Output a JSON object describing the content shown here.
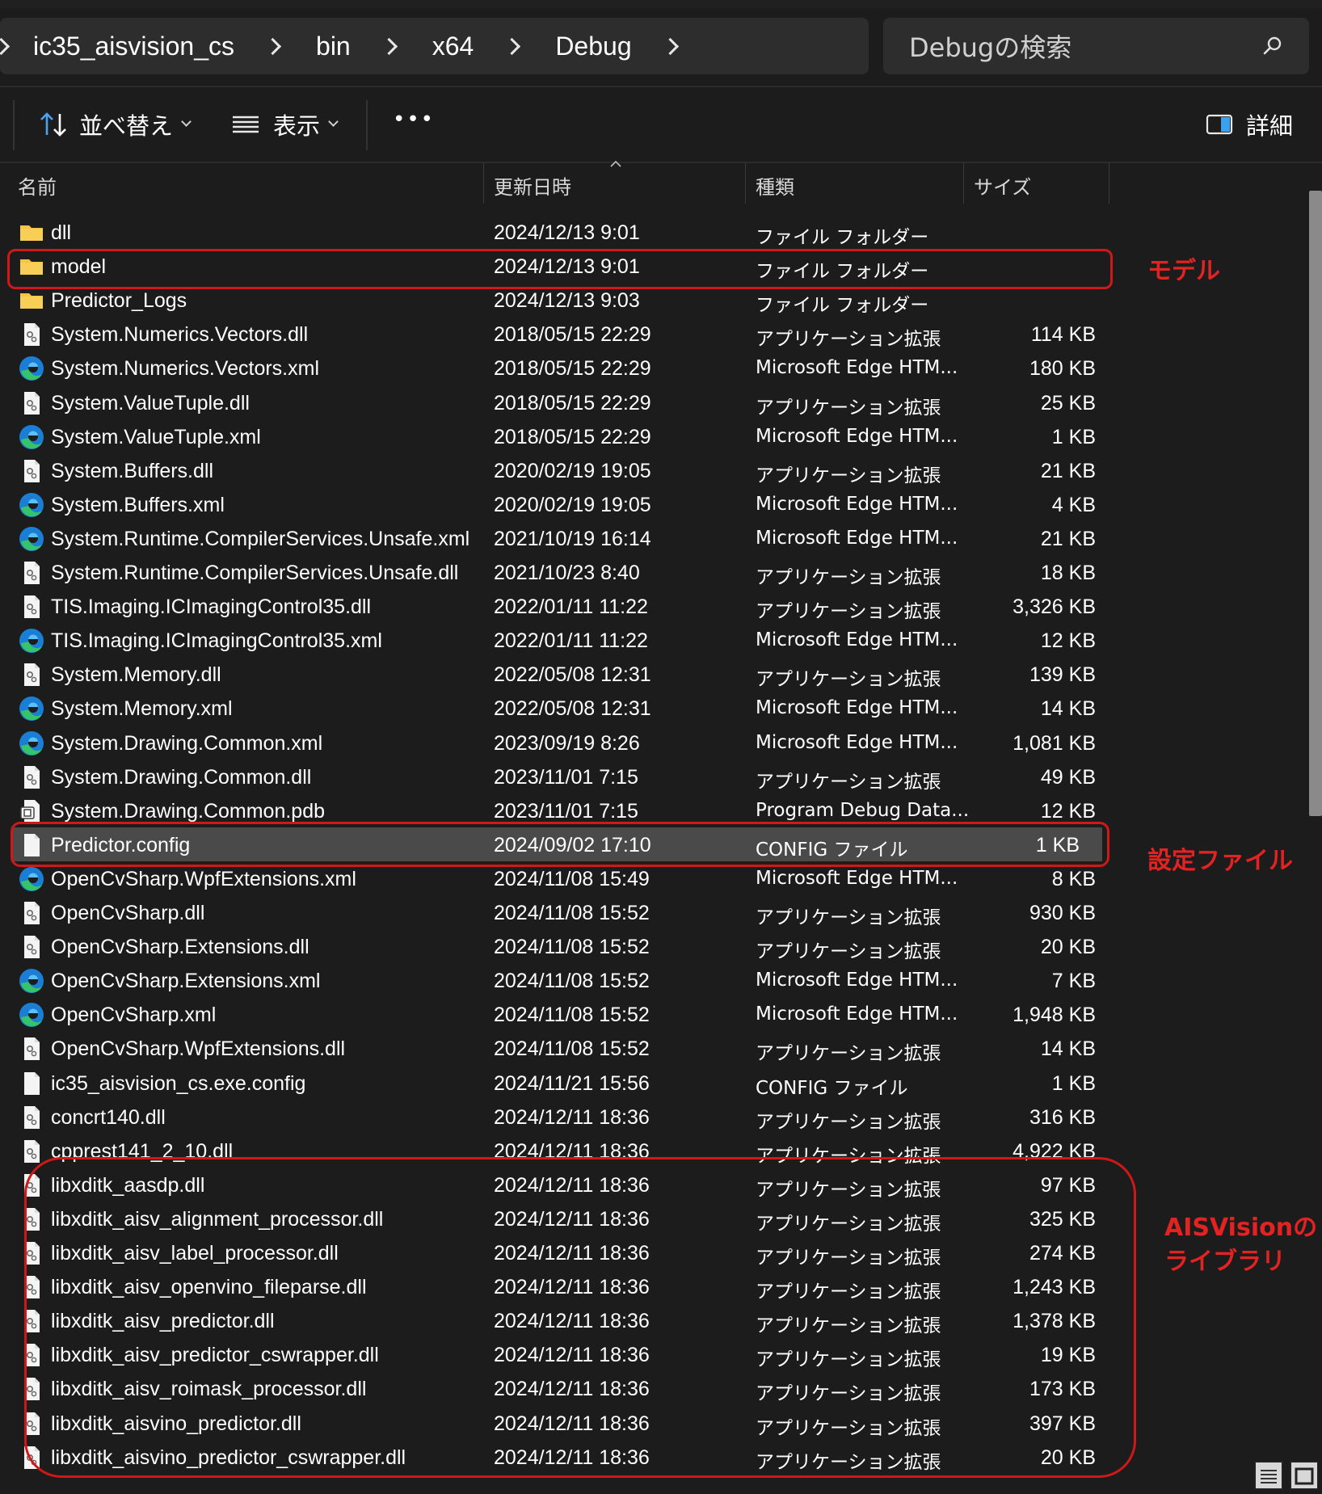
{
  "breadcrumb": {
    "items": [
      "ic35_aisvision_cs",
      "bin",
      "x64",
      "Debug"
    ]
  },
  "search": {
    "placeholder": "Debugの検索"
  },
  "toolbar": {
    "sort_label": "並べ替え",
    "view_label": "表示",
    "more_label": "•••",
    "details_label": "詳細"
  },
  "columns": {
    "name": "名前",
    "date": "更新日時",
    "type": "種類",
    "size": "サイズ"
  },
  "files": [
    {
      "icon": "folder-icon",
      "name": "dll",
      "date": "2024/12/13 9:01",
      "type": "ファイル フォルダー",
      "size": ""
    },
    {
      "icon": "folder-icon",
      "name": "model",
      "date": "2024/12/13 9:01",
      "type": "ファイル フォルダー",
      "size": ""
    },
    {
      "icon": "folder-icon",
      "name": "Predictor_Logs",
      "date": "2024/12/13 9:03",
      "type": "ファイル フォルダー",
      "size": ""
    },
    {
      "icon": "dll-icon",
      "name": "System.Numerics.Vectors.dll",
      "date": "2018/05/15 22:29",
      "type": "アプリケーション拡張",
      "size": "114 KB"
    },
    {
      "icon": "edge-icon",
      "name": "System.Numerics.Vectors.xml",
      "date": "2018/05/15 22:29",
      "type": "Microsoft Edge HTM...",
      "size": "180 KB"
    },
    {
      "icon": "dll-icon",
      "name": "System.ValueTuple.dll",
      "date": "2018/05/15 22:29",
      "type": "アプリケーション拡張",
      "size": "25 KB"
    },
    {
      "icon": "edge-icon",
      "name": "System.ValueTuple.xml",
      "date": "2018/05/15 22:29",
      "type": "Microsoft Edge HTM...",
      "size": "1 KB"
    },
    {
      "icon": "dll-icon",
      "name": "System.Buffers.dll",
      "date": "2020/02/19 19:05",
      "type": "アプリケーション拡張",
      "size": "21 KB"
    },
    {
      "icon": "edge-icon",
      "name": "System.Buffers.xml",
      "date": "2020/02/19 19:05",
      "type": "Microsoft Edge HTM...",
      "size": "4 KB"
    },
    {
      "icon": "edge-icon",
      "name": "System.Runtime.CompilerServices.Unsafe.xml",
      "date": "2021/10/19 16:14",
      "type": "Microsoft Edge HTM...",
      "size": "21 KB"
    },
    {
      "icon": "dll-icon",
      "name": "System.Runtime.CompilerServices.Unsafe.dll",
      "date": "2021/10/23 8:40",
      "type": "アプリケーション拡張",
      "size": "18 KB"
    },
    {
      "icon": "dll-icon",
      "name": "TIS.Imaging.ICImagingControl35.dll",
      "date": "2022/01/11 11:22",
      "type": "アプリケーション拡張",
      "size": "3,326 KB"
    },
    {
      "icon": "edge-icon",
      "name": "TIS.Imaging.ICImagingControl35.xml",
      "date": "2022/01/11 11:22",
      "type": "Microsoft Edge HTM...",
      "size": "12 KB"
    },
    {
      "icon": "dll-icon",
      "name": "System.Memory.dll",
      "date": "2022/05/08 12:31",
      "type": "アプリケーション拡張",
      "size": "139 KB"
    },
    {
      "icon": "edge-icon",
      "name": "System.Memory.xml",
      "date": "2022/05/08 12:31",
      "type": "Microsoft Edge HTM...",
      "size": "14 KB"
    },
    {
      "icon": "edge-icon",
      "name": "System.Drawing.Common.xml",
      "date": "2023/09/19 8:26",
      "type": "Microsoft Edge HTM...",
      "size": "1,081 KB"
    },
    {
      "icon": "dll-icon",
      "name": "System.Drawing.Common.dll",
      "date": "2023/11/01 7:15",
      "type": "アプリケーション拡張",
      "size": "49 KB"
    },
    {
      "icon": "pdb-icon",
      "name": "System.Drawing.Common.pdb",
      "date": "2023/11/01 7:15",
      "type": "Program Debug Data...",
      "size": "12 KB"
    },
    {
      "icon": "config-icon",
      "name": "Predictor.config",
      "date": "2024/09/02 17:10",
      "type": "CONFIG ファイル",
      "size": "1 KB",
      "selected": true
    },
    {
      "icon": "edge-icon",
      "name": "OpenCvSharp.WpfExtensions.xml",
      "date": "2024/11/08 15:49",
      "type": "Microsoft Edge HTM...",
      "size": "8 KB"
    },
    {
      "icon": "dll-icon",
      "name": "OpenCvSharp.dll",
      "date": "2024/11/08 15:52",
      "type": "アプリケーション拡張",
      "size": "930 KB"
    },
    {
      "icon": "dll-icon",
      "name": "OpenCvSharp.Extensions.dll",
      "date": "2024/11/08 15:52",
      "type": "アプリケーション拡張",
      "size": "20 KB"
    },
    {
      "icon": "edge-icon",
      "name": "OpenCvSharp.Extensions.xml",
      "date": "2024/11/08 15:52",
      "type": "Microsoft Edge HTM...",
      "size": "7 KB"
    },
    {
      "icon": "edge-icon",
      "name": "OpenCvSharp.xml",
      "date": "2024/11/08 15:52",
      "type": "Microsoft Edge HTM...",
      "size": "1,948 KB"
    },
    {
      "icon": "dll-icon",
      "name": "OpenCvSharp.WpfExtensions.dll",
      "date": "2024/11/08 15:52",
      "type": "アプリケーション拡張",
      "size": "14 KB"
    },
    {
      "icon": "config-icon",
      "name": "ic35_aisvision_cs.exe.config",
      "date": "2024/11/21 15:56",
      "type": "CONFIG ファイル",
      "size": "1 KB"
    },
    {
      "icon": "dll-icon",
      "name": "concrt140.dll",
      "date": "2024/12/11 18:36",
      "type": "アプリケーション拡張",
      "size": "316 KB"
    },
    {
      "icon": "dll-icon",
      "name": "cpprest141_2_10.dll",
      "date": "2024/12/11 18:36",
      "type": "アプリケーション拡張",
      "size": "4,922 KB"
    },
    {
      "icon": "dll-icon",
      "name": "libxditk_aasdp.dll",
      "date": "2024/12/11 18:36",
      "type": "アプリケーション拡張",
      "size": "97 KB"
    },
    {
      "icon": "dll-icon",
      "name": "libxditk_aisv_alignment_processor.dll",
      "date": "2024/12/11 18:36",
      "type": "アプリケーション拡張",
      "size": "325 KB"
    },
    {
      "icon": "dll-icon",
      "name": "libxditk_aisv_label_processor.dll",
      "date": "2024/12/11 18:36",
      "type": "アプリケーション拡張",
      "size": "274 KB"
    },
    {
      "icon": "dll-icon",
      "name": "libxditk_aisv_openvino_fileparse.dll",
      "date": "2024/12/11 18:36",
      "type": "アプリケーション拡張",
      "size": "1,243 KB"
    },
    {
      "icon": "dll-icon",
      "name": "libxditk_aisv_predictor.dll",
      "date": "2024/12/11 18:36",
      "type": "アプリケーション拡張",
      "size": "1,378 KB"
    },
    {
      "icon": "dll-icon",
      "name": "libxditk_aisv_predictor_cswrapper.dll",
      "date": "2024/12/11 18:36",
      "type": "アプリケーション拡張",
      "size": "19 KB"
    },
    {
      "icon": "dll-icon",
      "name": "libxditk_aisv_roimask_processor.dll",
      "date": "2024/12/11 18:36",
      "type": "アプリケーション拡張",
      "size": "173 KB"
    },
    {
      "icon": "dll-icon",
      "name": "libxditk_aisvino_predictor.dll",
      "date": "2024/12/11 18:36",
      "type": "アプリケーション拡張",
      "size": "397 KB"
    },
    {
      "icon": "dll-icon",
      "name": "libxditk_aisvino_predictor_cswrapper.dll",
      "date": "2024/12/11 18:36",
      "type": "アプリケーション拡張",
      "size": "20 KB"
    }
  ],
  "annotations": {
    "model_label": "モデル",
    "config_label": "設定ファイル",
    "library_label_line1": "AISVisionの",
    "library_label_line2": "ライブラリ",
    "color": "#e32222"
  },
  "colors": {
    "background": "#1c1c1c",
    "bar": "#2d2d2d",
    "selected_row": "#4a4a4a",
    "folder": "#f6c443",
    "edge_blue": "#1a7fd4",
    "edge_green": "#36c46b"
  }
}
